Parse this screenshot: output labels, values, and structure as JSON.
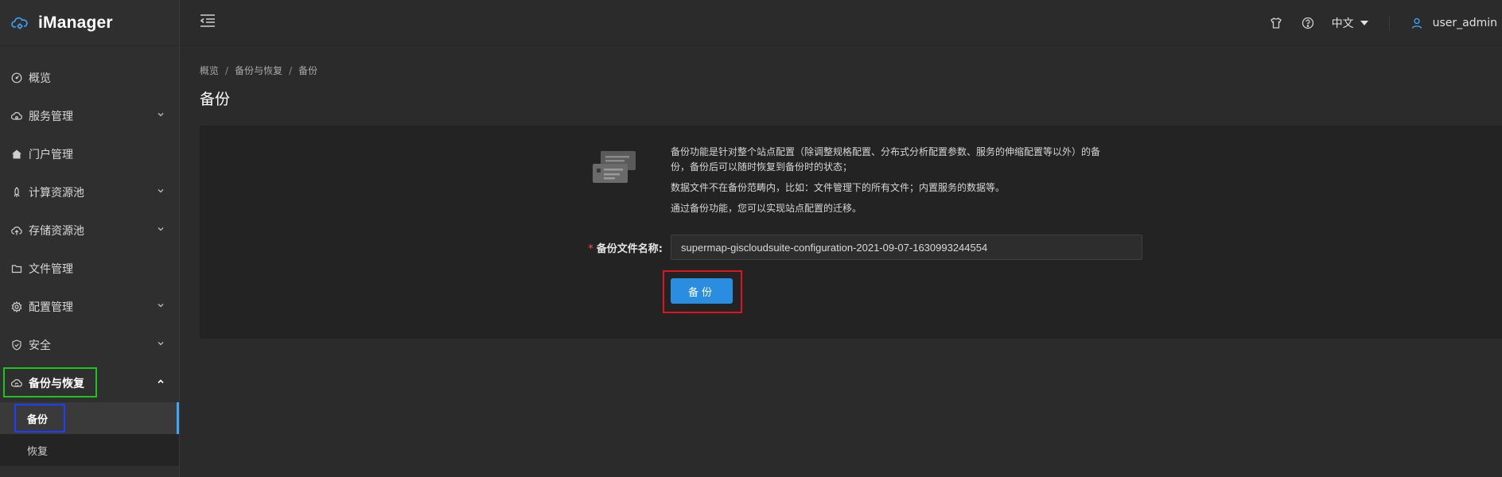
{
  "app": {
    "title": "iManager"
  },
  "sidebar": {
    "items": [
      {
        "label": "概览",
        "icon": "dashboard-icon",
        "has_children": false
      },
      {
        "label": "服务管理",
        "icon": "cloud-service-icon",
        "has_children": true
      },
      {
        "label": "门户管理",
        "icon": "home-icon",
        "has_children": false
      },
      {
        "label": "计算资源池",
        "icon": "rocket-icon",
        "has_children": true
      },
      {
        "label": "存储资源池",
        "icon": "cloud-upload-icon",
        "has_children": true
      },
      {
        "label": "文件管理",
        "icon": "folder-icon",
        "has_children": false
      },
      {
        "label": "配置管理",
        "icon": "gear-icon",
        "has_children": true
      },
      {
        "label": "安全",
        "icon": "shield-icon",
        "has_children": true
      },
      {
        "label": "备份与恢复",
        "icon": "cloud-sync-icon",
        "has_children": true,
        "expanded": true
      }
    ],
    "sub_items": [
      {
        "label": "备份",
        "selected": true
      },
      {
        "label": "恢复",
        "selected": false
      }
    ]
  },
  "topbar": {
    "language": "中文",
    "user": "user_admin"
  },
  "breadcrumb": [
    "概览",
    "备份与恢复",
    "备份"
  ],
  "page": {
    "title": "备份",
    "description": [
      "备份功能是针对整个站点配置（除调整规格配置、分布式分析配置参数、服务的伸缩配置等以外）的备份，备份后可以随时恢复到备份时的状态；",
      "数据文件不在备份范畴内，比如：文件管理下的所有文件；内置服务的数据等。",
      "通过备份功能，您可以实现站点配置的迁移。"
    ],
    "form": {
      "required_mark": "*",
      "label": "备份文件名称:",
      "value": "supermap-giscloudsuite-configuration-2021-09-07-1630993244554"
    },
    "button_label": "备份"
  },
  "colors": {
    "accent": "#3da6ff",
    "button": "#2b8de0",
    "highlight_green": "#1ec31e",
    "highlight_blue": "#1f3fff",
    "highlight_red": "#e0141e"
  }
}
